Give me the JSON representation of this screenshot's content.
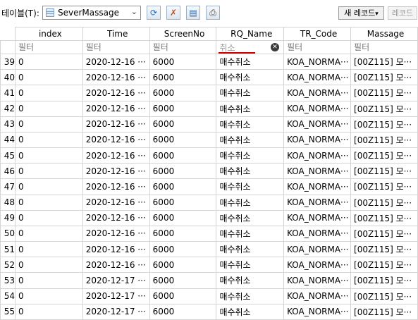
{
  "toolbar": {
    "table_label": "테이블(T):",
    "table_value": "SeverMassage",
    "new_record_label": "새 레코드",
    "delete_record_label": "레코드"
  },
  "columns": [
    "index",
    "Time",
    "ScreenNo",
    "RQ_Name",
    "TR_Code",
    "Massage"
  ],
  "filter": {
    "placeholder": "필터",
    "rq_name_value": "취소"
  },
  "rows": [
    {
      "rn": "39",
      "index": "0",
      "time": "2020-12-16 ···",
      "screen": "6000",
      "rq": "매수취소",
      "tr": "KOA_NORMA···",
      "msg": "[00Z115] 모···"
    },
    {
      "rn": "40",
      "index": "0",
      "time": "2020-12-16 ···",
      "screen": "6000",
      "rq": "매수취소",
      "tr": "KOA_NORMA···",
      "msg": "[00Z115] 모···"
    },
    {
      "rn": "41",
      "index": "0",
      "time": "2020-12-16 ···",
      "screen": "6000",
      "rq": "매수취소",
      "tr": "KOA_NORMA···",
      "msg": "[00Z115] 모···"
    },
    {
      "rn": "42",
      "index": "0",
      "time": "2020-12-16 ···",
      "screen": "6000",
      "rq": "매수취소",
      "tr": "KOA_NORMA···",
      "msg": "[00Z115] 모···"
    },
    {
      "rn": "43",
      "index": "0",
      "time": "2020-12-16 ···",
      "screen": "6000",
      "rq": "매수취소",
      "tr": "KOA_NORMA···",
      "msg": "[00Z115] 모···"
    },
    {
      "rn": "44",
      "index": "0",
      "time": "2020-12-16 ···",
      "screen": "6000",
      "rq": "매수취소",
      "tr": "KOA_NORMA···",
      "msg": "[00Z115] 모···"
    },
    {
      "rn": "45",
      "index": "0",
      "time": "2020-12-16 ···",
      "screen": "6000",
      "rq": "매수취소",
      "tr": "KOA_NORMA···",
      "msg": "[00Z115] 모···"
    },
    {
      "rn": "46",
      "index": "0",
      "time": "2020-12-16 ···",
      "screen": "6000",
      "rq": "매수취소",
      "tr": "KOA_NORMA···",
      "msg": "[00Z115] 모···"
    },
    {
      "rn": "47",
      "index": "0",
      "time": "2020-12-16 ···",
      "screen": "6000",
      "rq": "매수취소",
      "tr": "KOA_NORMA···",
      "msg": "[00Z115] 모···"
    },
    {
      "rn": "48",
      "index": "0",
      "time": "2020-12-16 ···",
      "screen": "6000",
      "rq": "매수취소",
      "tr": "KOA_NORMA···",
      "msg": "[00Z115] 모···"
    },
    {
      "rn": "49",
      "index": "0",
      "time": "2020-12-16 ···",
      "screen": "6000",
      "rq": "매수취소",
      "tr": "KOA_NORMA···",
      "msg": "[00Z115] 모···"
    },
    {
      "rn": "50",
      "index": "0",
      "time": "2020-12-16 ···",
      "screen": "6000",
      "rq": "매수취소",
      "tr": "KOA_NORMA···",
      "msg": "[00Z115] 모···"
    },
    {
      "rn": "51",
      "index": "0",
      "time": "2020-12-16 ···",
      "screen": "6000",
      "rq": "매수취소",
      "tr": "KOA_NORMA···",
      "msg": "[00Z115] 모···"
    },
    {
      "rn": "52",
      "index": "0",
      "time": "2020-12-16 ···",
      "screen": "6000",
      "rq": "매수취소",
      "tr": "KOA_NORMA···",
      "msg": "[00Z115] 모···"
    },
    {
      "rn": "53",
      "index": "0",
      "time": "2020-12-17 ···",
      "screen": "6000",
      "rq": "매수취소",
      "tr": "KOA_NORMA···",
      "msg": "[00Z115] 모···"
    },
    {
      "rn": "54",
      "index": "0",
      "time": "2020-12-17 ···",
      "screen": "6000",
      "rq": "매수취소",
      "tr": "KOA_NORMA···",
      "msg": "[00Z115] 모···"
    },
    {
      "rn": "55",
      "index": "0",
      "time": "2020-12-17 ···",
      "screen": "6000",
      "rq": "매수취소",
      "tr": "KOA_NORMA···",
      "msg": "[00Z115] 모···"
    }
  ],
  "icons": [
    "table-icon",
    "refresh-icon",
    "clear-filters-icon",
    "save-icon",
    "print-icon",
    "clear-filter-icon"
  ],
  "colors": {
    "accent_underline": "#d00000",
    "header_border": "#d4d4d4"
  }
}
